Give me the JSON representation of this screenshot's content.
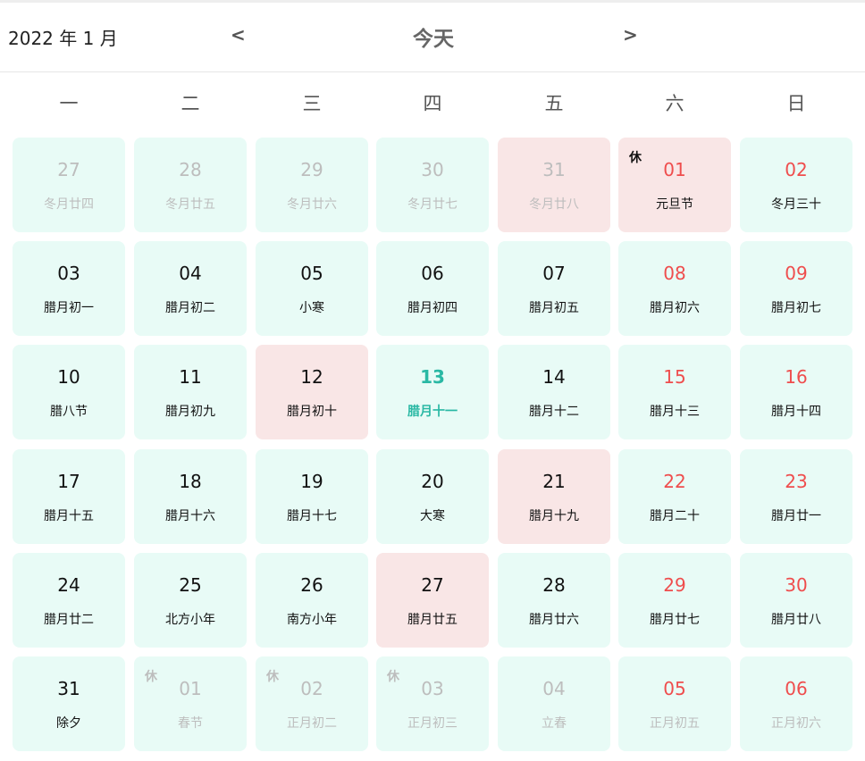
{
  "header": {
    "month_label": "2022 年 1 月",
    "prev_label": "<",
    "today_label": "今天",
    "next_label": ">"
  },
  "weekdays": [
    "一",
    "二",
    "三",
    "四",
    "五",
    "六",
    "日"
  ],
  "days": [
    {
      "day": "27",
      "sub": "冬月廿四",
      "other": true,
      "weekend": false,
      "hl": false,
      "rest": ""
    },
    {
      "day": "28",
      "sub": "冬月廿五",
      "other": true,
      "weekend": false,
      "hl": false,
      "rest": ""
    },
    {
      "day": "29",
      "sub": "冬月廿六",
      "other": true,
      "weekend": false,
      "hl": false,
      "rest": ""
    },
    {
      "day": "30",
      "sub": "冬月廿七",
      "other": true,
      "weekend": false,
      "hl": false,
      "rest": ""
    },
    {
      "day": "31",
      "sub": "冬月廿八",
      "other": true,
      "weekend": false,
      "hl": true,
      "rest": ""
    },
    {
      "day": "01",
      "sub": "元旦节",
      "other": false,
      "weekend": true,
      "hl": true,
      "rest": "休"
    },
    {
      "day": "02",
      "sub": "冬月三十",
      "other": false,
      "weekend": true,
      "hl": false,
      "rest": ""
    },
    {
      "day": "03",
      "sub": "腊月初一",
      "other": false,
      "weekend": false,
      "hl": false,
      "rest": ""
    },
    {
      "day": "04",
      "sub": "腊月初二",
      "other": false,
      "weekend": false,
      "hl": false,
      "rest": ""
    },
    {
      "day": "05",
      "sub": "小寒",
      "other": false,
      "weekend": false,
      "hl": false,
      "rest": ""
    },
    {
      "day": "06",
      "sub": "腊月初四",
      "other": false,
      "weekend": false,
      "hl": false,
      "rest": ""
    },
    {
      "day": "07",
      "sub": "腊月初五",
      "other": false,
      "weekend": false,
      "hl": false,
      "rest": ""
    },
    {
      "day": "08",
      "sub": "腊月初六",
      "other": false,
      "weekend": true,
      "hl": false,
      "rest": ""
    },
    {
      "day": "09",
      "sub": "腊月初七",
      "other": false,
      "weekend": true,
      "hl": false,
      "rest": ""
    },
    {
      "day": "10",
      "sub": "腊八节",
      "other": false,
      "weekend": false,
      "hl": false,
      "rest": ""
    },
    {
      "day": "11",
      "sub": "腊月初九",
      "other": false,
      "weekend": false,
      "hl": false,
      "rest": ""
    },
    {
      "day": "12",
      "sub": "腊月初十",
      "other": false,
      "weekend": false,
      "hl": true,
      "rest": ""
    },
    {
      "day": "13",
      "sub": "腊月十一",
      "other": false,
      "weekend": false,
      "hl": false,
      "rest": "",
      "today": true
    },
    {
      "day": "14",
      "sub": "腊月十二",
      "other": false,
      "weekend": false,
      "hl": false,
      "rest": ""
    },
    {
      "day": "15",
      "sub": "腊月十三",
      "other": false,
      "weekend": true,
      "hl": false,
      "rest": ""
    },
    {
      "day": "16",
      "sub": "腊月十四",
      "other": false,
      "weekend": true,
      "hl": false,
      "rest": ""
    },
    {
      "day": "17",
      "sub": "腊月十五",
      "other": false,
      "weekend": false,
      "hl": false,
      "rest": ""
    },
    {
      "day": "18",
      "sub": "腊月十六",
      "other": false,
      "weekend": false,
      "hl": false,
      "rest": ""
    },
    {
      "day": "19",
      "sub": "腊月十七",
      "other": false,
      "weekend": false,
      "hl": false,
      "rest": ""
    },
    {
      "day": "20",
      "sub": "大寒",
      "other": false,
      "weekend": false,
      "hl": false,
      "rest": ""
    },
    {
      "day": "21",
      "sub": "腊月十九",
      "other": false,
      "weekend": false,
      "hl": true,
      "rest": ""
    },
    {
      "day": "22",
      "sub": "腊月二十",
      "other": false,
      "weekend": true,
      "hl": false,
      "rest": ""
    },
    {
      "day": "23",
      "sub": "腊月廿一",
      "other": false,
      "weekend": true,
      "hl": false,
      "rest": ""
    },
    {
      "day": "24",
      "sub": "腊月廿二",
      "other": false,
      "weekend": false,
      "hl": false,
      "rest": ""
    },
    {
      "day": "25",
      "sub": "北方小年",
      "other": false,
      "weekend": false,
      "hl": false,
      "rest": ""
    },
    {
      "day": "26",
      "sub": "南方小年",
      "other": false,
      "weekend": false,
      "hl": false,
      "rest": ""
    },
    {
      "day": "27",
      "sub": "腊月廿五",
      "other": false,
      "weekend": false,
      "hl": true,
      "rest": ""
    },
    {
      "day": "28",
      "sub": "腊月廿六",
      "other": false,
      "weekend": false,
      "hl": false,
      "rest": ""
    },
    {
      "day": "29",
      "sub": "腊月廿七",
      "other": false,
      "weekend": true,
      "hl": false,
      "rest": ""
    },
    {
      "day": "30",
      "sub": "腊月廿八",
      "other": false,
      "weekend": true,
      "hl": false,
      "rest": ""
    },
    {
      "day": "31",
      "sub": "除夕",
      "other": false,
      "weekend": false,
      "hl": false,
      "rest": ""
    },
    {
      "day": "01",
      "sub": "春节",
      "other": true,
      "weekend": false,
      "hl": false,
      "rest": "休"
    },
    {
      "day": "02",
      "sub": "正月初二",
      "other": true,
      "weekend": false,
      "hl": false,
      "rest": "休"
    },
    {
      "day": "03",
      "sub": "正月初三",
      "other": true,
      "weekend": false,
      "hl": false,
      "rest": "休"
    },
    {
      "day": "04",
      "sub": "立春",
      "other": true,
      "weekend": false,
      "hl": false,
      "rest": ""
    },
    {
      "day": "05",
      "sub": "正月初五",
      "other": true,
      "weekend": true,
      "hl": false,
      "rest": ""
    },
    {
      "day": "06",
      "sub": "正月初六",
      "other": true,
      "weekend": true,
      "hl": false,
      "rest": ""
    }
  ],
  "colors": {
    "cell_bg": "#e8fbf6",
    "cell_highlight_bg": "#f9e6e6",
    "weekend_red": "#ef4d4d",
    "other_month_gray": "#bdbdbd",
    "today_teal": "#2ab8a4"
  }
}
